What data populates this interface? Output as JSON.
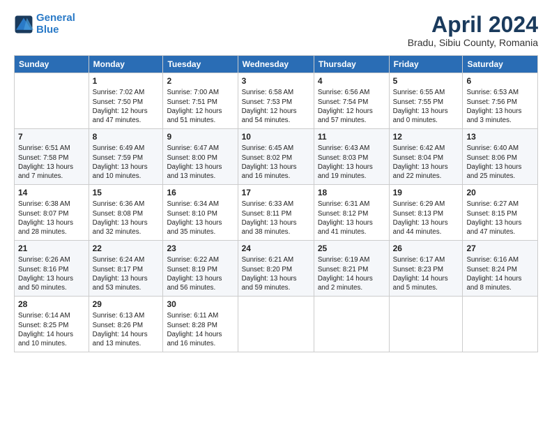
{
  "logo": {
    "text_general": "General",
    "text_blue": "Blue"
  },
  "header": {
    "title": "April 2024",
    "location": "Bradu, Sibiu County, Romania"
  },
  "weekdays": [
    "Sunday",
    "Monday",
    "Tuesday",
    "Wednesday",
    "Thursday",
    "Friday",
    "Saturday"
  ],
  "weeks": [
    [
      {
        "day": "",
        "info": ""
      },
      {
        "day": "1",
        "info": "Sunrise: 7:02 AM\nSunset: 7:50 PM\nDaylight: 12 hours\nand 47 minutes."
      },
      {
        "day": "2",
        "info": "Sunrise: 7:00 AM\nSunset: 7:51 PM\nDaylight: 12 hours\nand 51 minutes."
      },
      {
        "day": "3",
        "info": "Sunrise: 6:58 AM\nSunset: 7:53 PM\nDaylight: 12 hours\nand 54 minutes."
      },
      {
        "day": "4",
        "info": "Sunrise: 6:56 AM\nSunset: 7:54 PM\nDaylight: 12 hours\nand 57 minutes."
      },
      {
        "day": "5",
        "info": "Sunrise: 6:55 AM\nSunset: 7:55 PM\nDaylight: 13 hours\nand 0 minutes."
      },
      {
        "day": "6",
        "info": "Sunrise: 6:53 AM\nSunset: 7:56 PM\nDaylight: 13 hours\nand 3 minutes."
      }
    ],
    [
      {
        "day": "7",
        "info": "Sunrise: 6:51 AM\nSunset: 7:58 PM\nDaylight: 13 hours\nand 7 minutes."
      },
      {
        "day": "8",
        "info": "Sunrise: 6:49 AM\nSunset: 7:59 PM\nDaylight: 13 hours\nand 10 minutes."
      },
      {
        "day": "9",
        "info": "Sunrise: 6:47 AM\nSunset: 8:00 PM\nDaylight: 13 hours\nand 13 minutes."
      },
      {
        "day": "10",
        "info": "Sunrise: 6:45 AM\nSunset: 8:02 PM\nDaylight: 13 hours\nand 16 minutes."
      },
      {
        "day": "11",
        "info": "Sunrise: 6:43 AM\nSunset: 8:03 PM\nDaylight: 13 hours\nand 19 minutes."
      },
      {
        "day": "12",
        "info": "Sunrise: 6:42 AM\nSunset: 8:04 PM\nDaylight: 13 hours\nand 22 minutes."
      },
      {
        "day": "13",
        "info": "Sunrise: 6:40 AM\nSunset: 8:06 PM\nDaylight: 13 hours\nand 25 minutes."
      }
    ],
    [
      {
        "day": "14",
        "info": "Sunrise: 6:38 AM\nSunset: 8:07 PM\nDaylight: 13 hours\nand 28 minutes."
      },
      {
        "day": "15",
        "info": "Sunrise: 6:36 AM\nSunset: 8:08 PM\nDaylight: 13 hours\nand 32 minutes."
      },
      {
        "day": "16",
        "info": "Sunrise: 6:34 AM\nSunset: 8:10 PM\nDaylight: 13 hours\nand 35 minutes."
      },
      {
        "day": "17",
        "info": "Sunrise: 6:33 AM\nSunset: 8:11 PM\nDaylight: 13 hours\nand 38 minutes."
      },
      {
        "day": "18",
        "info": "Sunrise: 6:31 AM\nSunset: 8:12 PM\nDaylight: 13 hours\nand 41 minutes."
      },
      {
        "day": "19",
        "info": "Sunrise: 6:29 AM\nSunset: 8:13 PM\nDaylight: 13 hours\nand 44 minutes."
      },
      {
        "day": "20",
        "info": "Sunrise: 6:27 AM\nSunset: 8:15 PM\nDaylight: 13 hours\nand 47 minutes."
      }
    ],
    [
      {
        "day": "21",
        "info": "Sunrise: 6:26 AM\nSunset: 8:16 PM\nDaylight: 13 hours\nand 50 minutes."
      },
      {
        "day": "22",
        "info": "Sunrise: 6:24 AM\nSunset: 8:17 PM\nDaylight: 13 hours\nand 53 minutes."
      },
      {
        "day": "23",
        "info": "Sunrise: 6:22 AM\nSunset: 8:19 PM\nDaylight: 13 hours\nand 56 minutes."
      },
      {
        "day": "24",
        "info": "Sunrise: 6:21 AM\nSunset: 8:20 PM\nDaylight: 13 hours\nand 59 minutes."
      },
      {
        "day": "25",
        "info": "Sunrise: 6:19 AM\nSunset: 8:21 PM\nDaylight: 14 hours\nand 2 minutes."
      },
      {
        "day": "26",
        "info": "Sunrise: 6:17 AM\nSunset: 8:23 PM\nDaylight: 14 hours\nand 5 minutes."
      },
      {
        "day": "27",
        "info": "Sunrise: 6:16 AM\nSunset: 8:24 PM\nDaylight: 14 hours\nand 8 minutes."
      }
    ],
    [
      {
        "day": "28",
        "info": "Sunrise: 6:14 AM\nSunset: 8:25 PM\nDaylight: 14 hours\nand 10 minutes."
      },
      {
        "day": "29",
        "info": "Sunrise: 6:13 AM\nSunset: 8:26 PM\nDaylight: 14 hours\nand 13 minutes."
      },
      {
        "day": "30",
        "info": "Sunrise: 6:11 AM\nSunset: 8:28 PM\nDaylight: 14 hours\nand 16 minutes."
      },
      {
        "day": "",
        "info": ""
      },
      {
        "day": "",
        "info": ""
      },
      {
        "day": "",
        "info": ""
      },
      {
        "day": "",
        "info": ""
      }
    ]
  ]
}
